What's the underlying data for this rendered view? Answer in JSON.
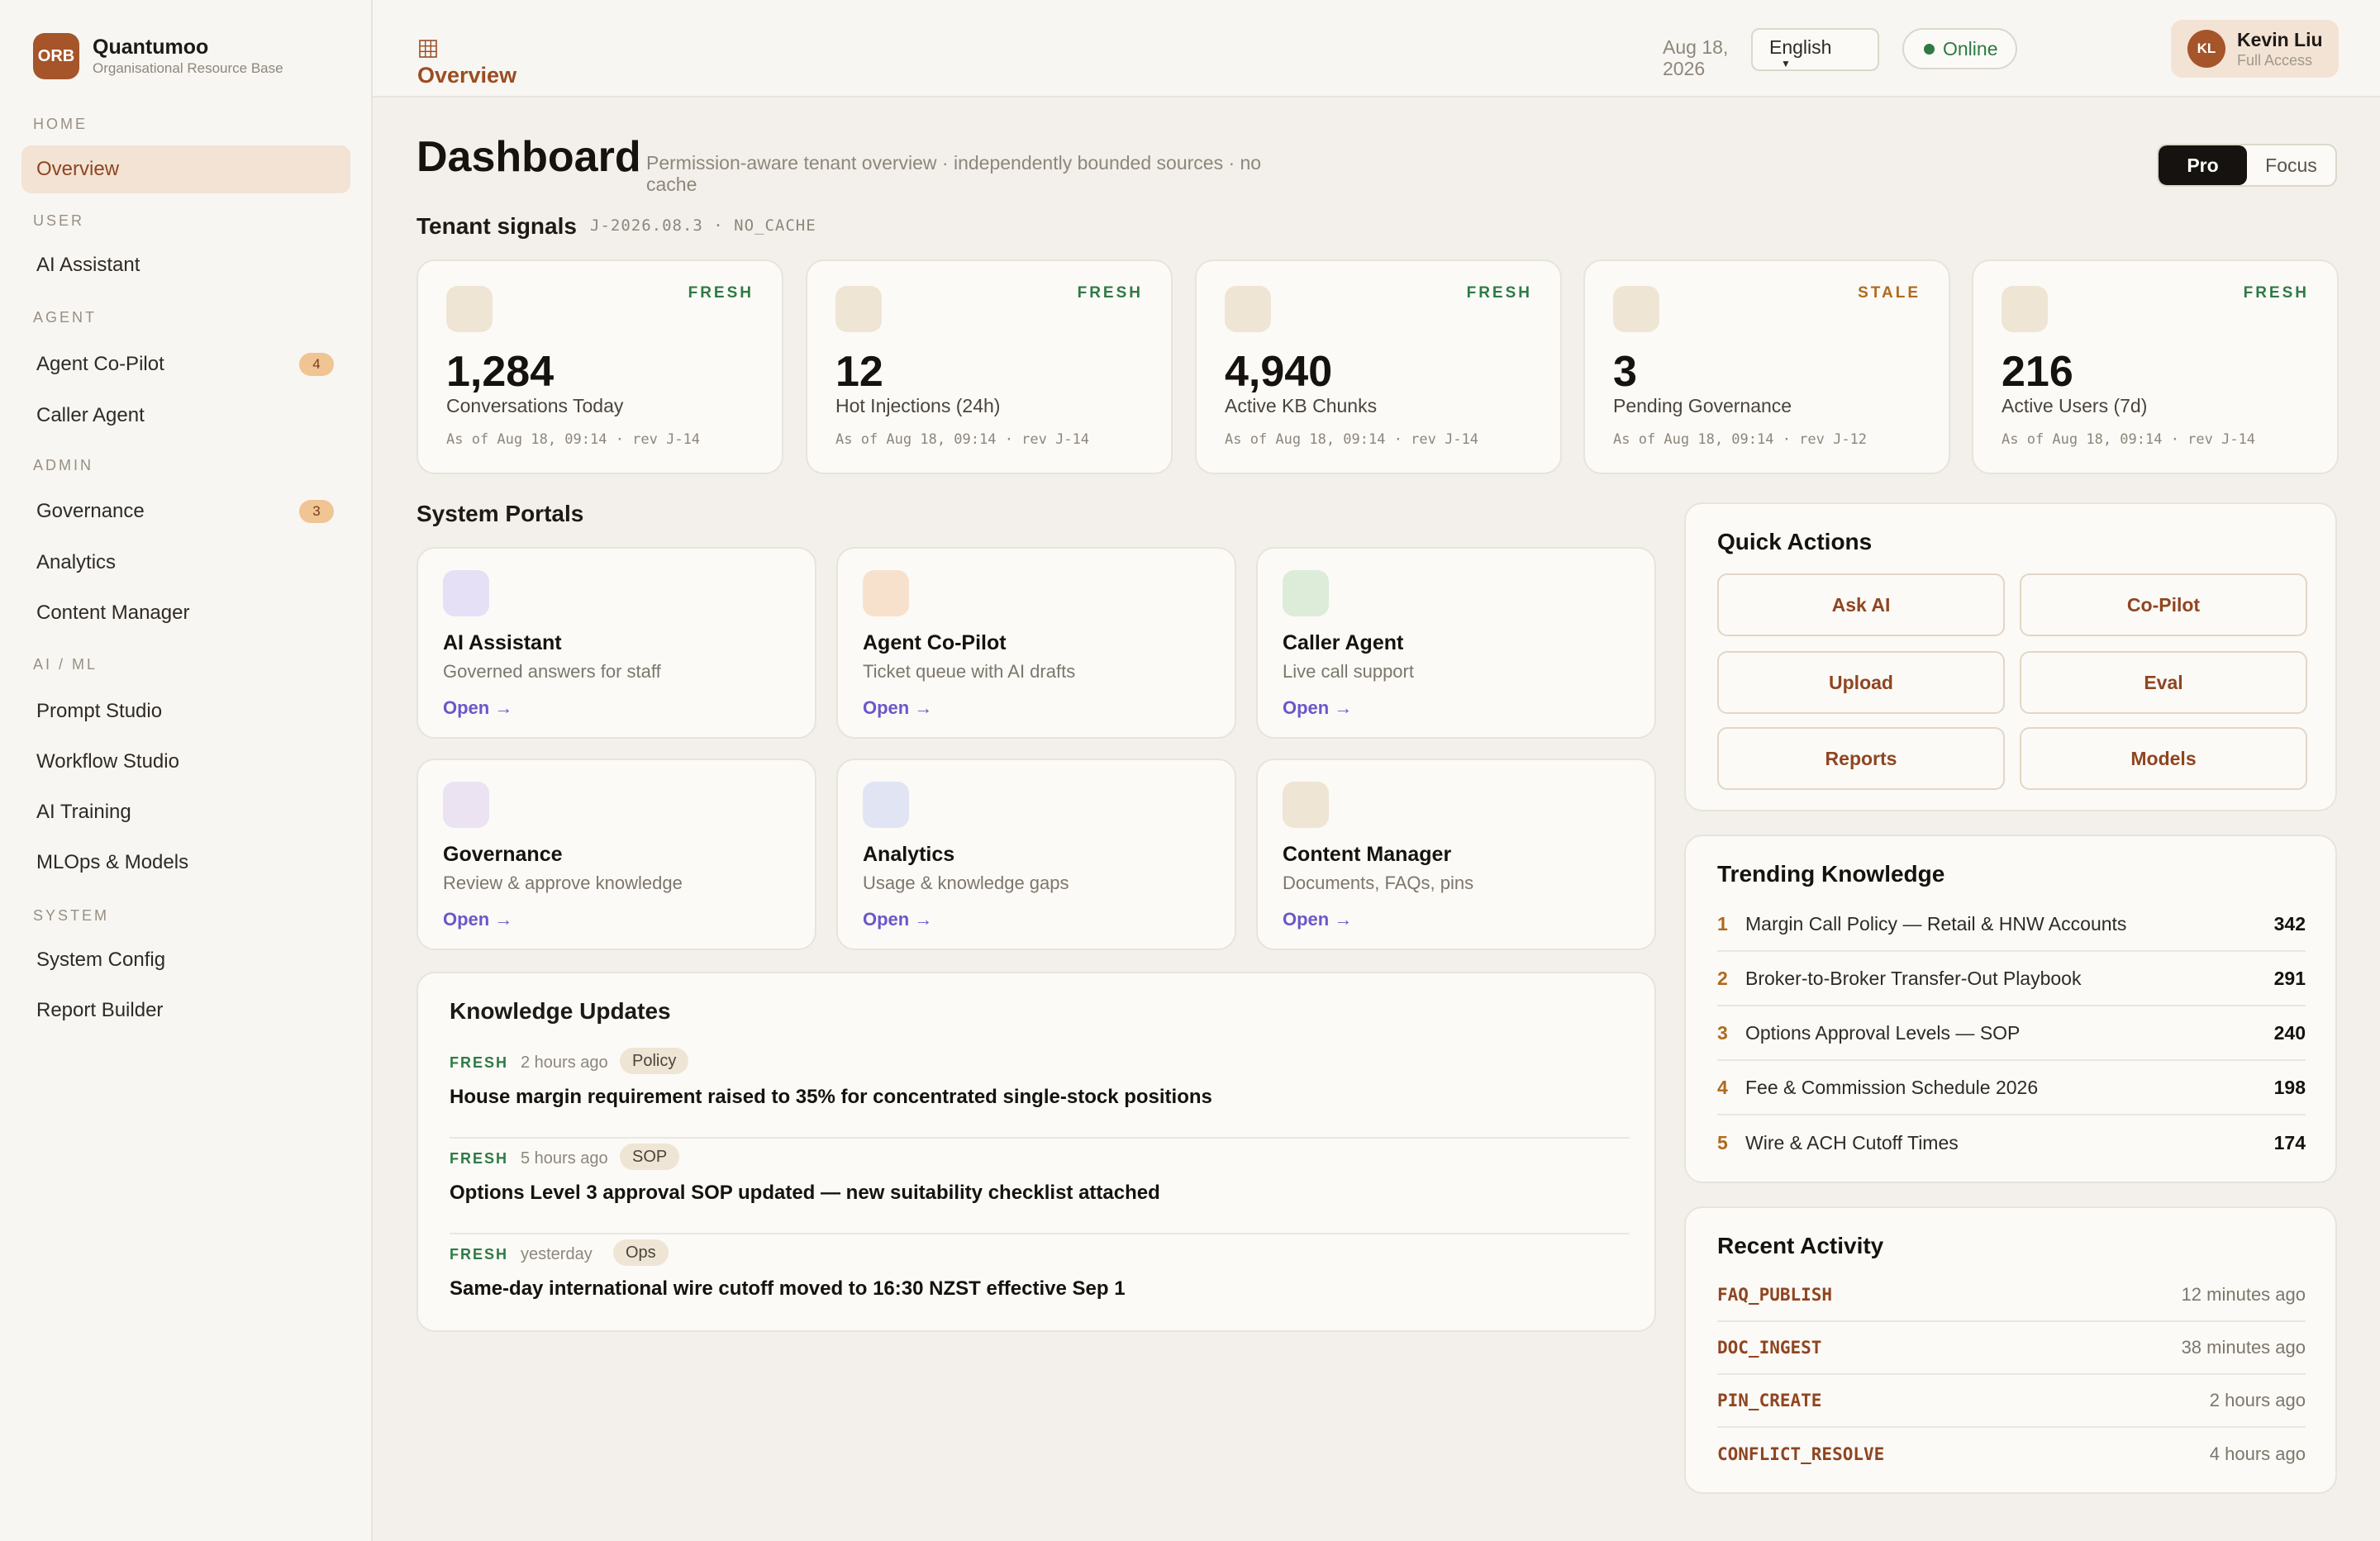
{
  "brand": {
    "logo": "ORB",
    "name": "Quantumoo",
    "subtitle": "Organisational Resource Base"
  },
  "sidebar": {
    "sections": [
      {
        "label": "HOME"
      },
      {
        "label": "USER"
      },
      {
        "label": "AGENT"
      },
      {
        "label": "ADMIN"
      },
      {
        "label": "AI / ML"
      },
      {
        "label": "SYSTEM"
      }
    ],
    "items": [
      {
        "label": "Overview",
        "active": true
      },
      {
        "label": "AI Assistant"
      },
      {
        "label": "Agent Co-Pilot",
        "badge": "4"
      },
      {
        "label": "Caller Agent"
      },
      {
        "label": "Governance",
        "badge": "3"
      },
      {
        "label": "Analytics"
      },
      {
        "label": "Content Manager"
      },
      {
        "label": "Prompt Studio"
      },
      {
        "label": "Workflow Studio"
      },
      {
        "label": "AI Training"
      },
      {
        "label": "MLOps & Models"
      },
      {
        "label": "System Config"
      },
      {
        "label": "Report Builder"
      }
    ]
  },
  "topbar": {
    "breadcrumb_icon": "grid-icon",
    "title": "Overview",
    "language": "English",
    "status": "Online",
    "status_color": "#2e7a44",
    "date_line1": "Aug 18,",
    "date_line2": "2026",
    "user": {
      "initials": "KL",
      "name": "Kevin Liu",
      "role": "Full Access"
    }
  },
  "header": {
    "title": "Dashboard",
    "subtitle": "Permission-aware tenant overview · independently bounded sources · no cache",
    "toggle": {
      "options": [
        "Pro",
        "Focus"
      ],
      "selected": "Pro"
    }
  },
  "signals": {
    "title": "Tenant signals",
    "meta": "J-2026.08.3 · NO_CACHE",
    "cards": [
      {
        "status": "FRESH",
        "value": "1,284",
        "label": "Conversations Today",
        "stamp": "As of Aug 18, 09:14 · rev J-14"
      },
      {
        "status": "FRESH",
        "value": "12",
        "label": "Hot Injections (24h)",
        "stamp": "As of Aug 18, 09:14 · rev J-14"
      },
      {
        "status": "FRESH",
        "value": "4,940",
        "label": "Active KB Chunks",
        "stamp": "As of Aug 18, 09:14 · rev J-14"
      },
      {
        "status": "STALE",
        "value": "3",
        "label": "Pending Governance",
        "stamp": "As of Aug 18, 09:14 · rev J-12"
      },
      {
        "status": "FRESH",
        "value": "216",
        "label": "Active Users (7d)",
        "stamp": "As of Aug 18, 09:14 · rev J-14"
      }
    ]
  },
  "portals": {
    "title": "System Portals",
    "items": [
      {
        "name": "AI Assistant",
        "desc": "Governed answers for staff",
        "link": "Open →",
        "color": "#e6e0f7"
      },
      {
        "name": "Agent Co-Pilot",
        "desc": "Ticket queue with AI drafts",
        "link": "Open →",
        "color": "#f8e1cc"
      },
      {
        "name": "Caller Agent",
        "desc": "Live call support",
        "link": "Open →",
        "color": "#dcecd9"
      },
      {
        "name": "Governance",
        "desc": "Review & approve knowledge",
        "link": "Open →",
        "color": "#ebe2f2"
      },
      {
        "name": "Analytics",
        "desc": "Usage & knowledge gaps",
        "link": "Open →",
        "color": "#e1e5f3"
      },
      {
        "name": "Content Manager",
        "desc": "Documents, FAQs, pins",
        "link": "Open →",
        "color": "#efe5d4"
      }
    ]
  },
  "updates": {
    "title": "Knowledge Updates",
    "items": [
      {
        "status": "FRESH",
        "time": "2 hours ago",
        "tag": "Policy",
        "text": "House margin requirement raised to 35% for concentrated single-stock positions"
      },
      {
        "status": "FRESH",
        "time": "5 hours ago",
        "tag": "SOP",
        "text": "Options Level 3 approval SOP updated — new suitability checklist attached"
      },
      {
        "status": "FRESH",
        "time": "yesterday",
        "tag": "Ops",
        "text": "Same-day international wire cutoff moved to 16:30 NZST effective Sep 1"
      }
    ]
  },
  "quick_actions": {
    "title": "Quick Actions",
    "buttons": [
      "Ask AI",
      "Co-Pilot",
      "Upload",
      "Eval",
      "Reports",
      "Models"
    ]
  },
  "trending": {
    "title": "Trending Knowledge",
    "items": [
      {
        "rank": "1",
        "text": "Margin Call Policy — Retail & HNW Accounts",
        "count": "342"
      },
      {
        "rank": "2",
        "text": "Broker-to-Broker Transfer-Out Playbook",
        "count": "291"
      },
      {
        "rank": "3",
        "text": "Options Approval Levels — SOP",
        "count": "240"
      },
      {
        "rank": "4",
        "text": "Fee & Commission Schedule 2026",
        "count": "198"
      },
      {
        "rank": "5",
        "text": "Wire & ACH Cutoff Times",
        "count": "174"
      }
    ]
  },
  "activity": {
    "title": "Recent Activity",
    "items": [
      {
        "code": "FAQ_PUBLISH",
        "time": "12 minutes ago"
      },
      {
        "code": "DOC_INGEST",
        "time": "38 minutes ago"
      },
      {
        "code": "PIN_CREATE",
        "time": "2 hours ago"
      },
      {
        "code": "CONFLICT_RESOLVE",
        "time": "4 hours ago"
      }
    ]
  }
}
